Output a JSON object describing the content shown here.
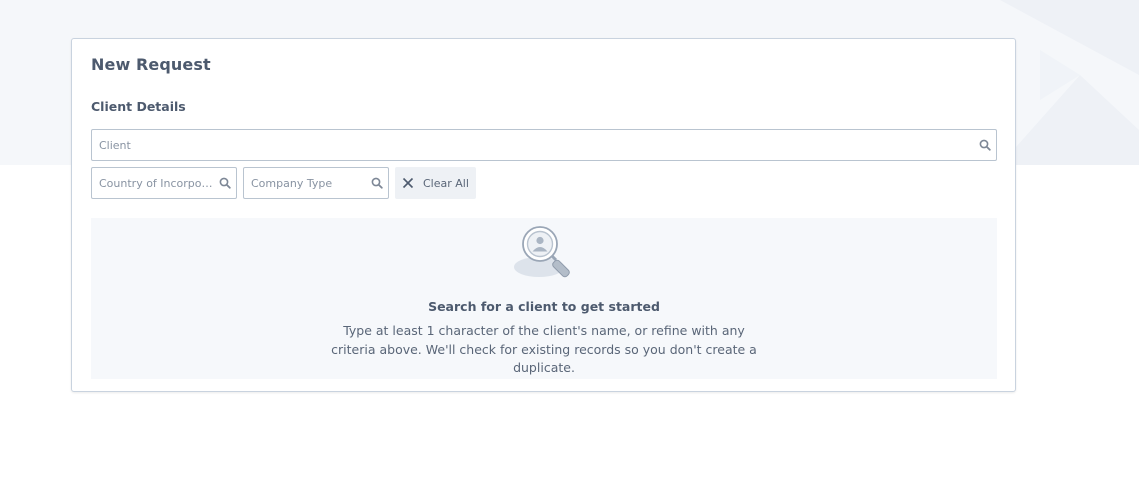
{
  "form": {
    "title": "New Request",
    "section_label": "Client Details",
    "client_placeholder": "Client",
    "country_placeholder": "Country of Incorporation",
    "company_type_placeholder": "Company Type",
    "clear_all_label": "Clear All"
  },
  "empty_state": {
    "heading": "Search for a client to get started",
    "description": "Type at least 1 character of the client's name, or refine with any criteria above. We'll check for existing records so you don't create a duplicate.",
    "icon": "magnifier-user-icon"
  },
  "colors": {
    "background_band": "#f5f7fa",
    "card_border": "#c9d3df",
    "text_primary": "#4d5a6e",
    "placeholder": "#8893a2",
    "empty_panel": "#f6f8fb"
  }
}
